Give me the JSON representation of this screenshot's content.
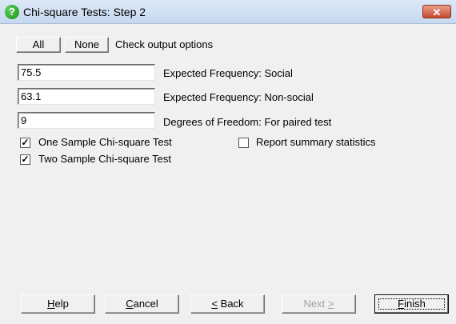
{
  "window": {
    "title": "Chi-square Tests: Step 2",
    "close_label": "✕"
  },
  "toolbar": {
    "all_label": "All",
    "none_label": "None",
    "hint": "Check output options"
  },
  "fields": [
    {
      "value": "75.5",
      "label": "Expected Frequency: Social"
    },
    {
      "value": "63.1",
      "label": "Expected Frequency: Non-social"
    },
    {
      "value": "9",
      "label": "Degrees of Freedom: For paired test"
    }
  ],
  "checkboxes": [
    {
      "label": "One Sample Chi-square Test",
      "checked": true
    },
    {
      "label": "Two Sample Chi-square Test",
      "checked": true
    },
    {
      "label": "Report summary statistics",
      "checked": false
    }
  ],
  "buttons": {
    "help": {
      "accel": "H",
      "rest": "elp"
    },
    "cancel": {
      "accel": "C",
      "rest": "ancel"
    },
    "back": {
      "accel": "<",
      "rest": " Back"
    },
    "next": {
      "pre": "Next ",
      "accel": ">"
    },
    "finish": {
      "accel": "F",
      "rest": "inish"
    }
  }
}
